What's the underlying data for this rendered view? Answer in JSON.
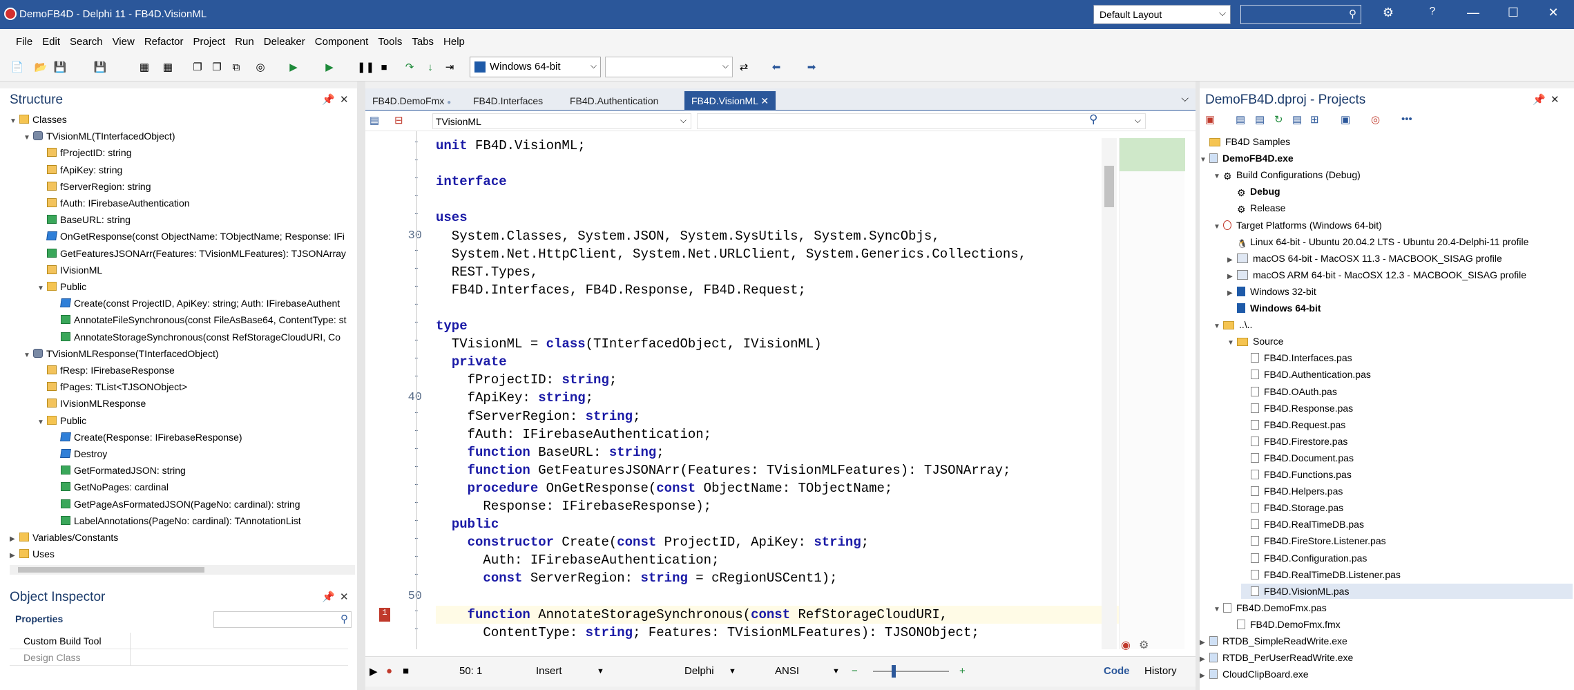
{
  "titlebar": {
    "title": "DemoFB4D - Delphi 11 - FB4D.VisionML",
    "layout": "Default Layout",
    "search_placeholder": ""
  },
  "menu": [
    "File",
    "Edit",
    "Search",
    "View",
    "Refactor",
    "Project",
    "Run",
    "Deleaker",
    "Component",
    "Tools",
    "Tabs",
    "Help"
  ],
  "toolbar": {
    "platform": "Windows 64-bit",
    "config": ""
  },
  "structure": {
    "title": "Structure",
    "items": [
      {
        "t": "Classes",
        "l": 0,
        "icon": "folder"
      },
      {
        "t": "TVisionML(TInterfacedObject)",
        "l": 1,
        "icon": "class"
      },
      {
        "t": "fProjectID: string",
        "l": 2,
        "icon": "field"
      },
      {
        "t": "fApiKey: string",
        "l": 2,
        "icon": "field"
      },
      {
        "t": "fServerRegion: string",
        "l": 2,
        "icon": "field"
      },
      {
        "t": "fAuth: IFirebaseAuthentication",
        "l": 2,
        "icon": "field"
      },
      {
        "t": "BaseURL: string",
        "l": 2,
        "icon": "green"
      },
      {
        "t": "OnGetResponse(const ObjectName: TObjectName; Response: IFi",
        "l": 2,
        "icon": "method"
      },
      {
        "t": "GetFeaturesJSONArr(Features: TVisionMLFeatures): TJSONArray",
        "l": 2,
        "icon": "green"
      },
      {
        "t": "IVisionML",
        "l": 2,
        "icon": "field"
      },
      {
        "t": "Public",
        "l": 2,
        "icon": "folder"
      },
      {
        "t": "Create(const ProjectID, ApiKey: string; Auth: IFirebaseAuthent",
        "l": 3,
        "icon": "method"
      },
      {
        "t": "AnnotateFileSynchronous(const FileAsBase64, ContentType: st",
        "l": 3,
        "icon": "green"
      },
      {
        "t": "AnnotateStorageSynchronous(const RefStorageCloudURI, Co",
        "l": 3,
        "icon": "green"
      },
      {
        "t": "TVisionMLResponse(TInterfacedObject)",
        "l": 1,
        "icon": "class"
      },
      {
        "t": "fResp: IFirebaseResponse",
        "l": 2,
        "icon": "field"
      },
      {
        "t": "fPages: TList<TJSONObject>",
        "l": 2,
        "icon": "field"
      },
      {
        "t": "IVisionMLResponse",
        "l": 2,
        "icon": "field"
      },
      {
        "t": "Public",
        "l": 2,
        "icon": "folder"
      },
      {
        "t": "Create(Response: IFirebaseResponse)",
        "l": 3,
        "icon": "method"
      },
      {
        "t": "Destroy",
        "l": 3,
        "icon": "method"
      },
      {
        "t": "GetFormatedJSON: string",
        "l": 3,
        "icon": "green"
      },
      {
        "t": "GetNoPages: cardinal",
        "l": 3,
        "icon": "green"
      },
      {
        "t": "GetPageAsFormatedJSON(PageNo: cardinal): string",
        "l": 3,
        "icon": "green"
      },
      {
        "t": "LabelAnnotations(PageNo: cardinal): TAnnotationList",
        "l": 3,
        "icon": "green"
      },
      {
        "t": "Variables/Constants",
        "l": 0,
        "icon": "folder"
      },
      {
        "t": "Uses",
        "l": 0,
        "icon": "folder"
      }
    ]
  },
  "object_inspector": {
    "title": "Object Inspector",
    "tab": "Properties",
    "rows": [
      {
        "k": "Custom Build Tool",
        "v": ""
      },
      {
        "k": "Design Class",
        "v": ""
      }
    ]
  },
  "editor": {
    "tabs": [
      "FB4D.DemoFmx",
      "FB4D.Interfaces",
      "FB4D.Authentication",
      "FB4D.VisionML"
    ],
    "nav": "TVisionML",
    "gutter": [
      "-",
      "-",
      "-",
      "-",
      "-",
      "30",
      "-",
      "-",
      "-",
      "-",
      "-",
      "-",
      "-",
      "-",
      "40",
      "-",
      "-",
      "-",
      "-",
      "-",
      "-",
      "-",
      "-",
      "-",
      "-",
      "50",
      "-"
    ],
    "lines": [
      "unit FB4D.VisionML;",
      "",
      "interface",
      "",
      "uses",
      "  System.Classes, System.JSON, System.SysUtils, System.SyncObjs,",
      "  System.Net.HttpClient, System.Net.URLClient, System.Generics.Collections,",
      "  REST.Types,",
      "  FB4D.Interfaces, FB4D.Response, FB4D.Request;",
      "",
      "type",
      "  TVisionML = class(TInterfacedObject, IVisionML)",
      "  private",
      "    fProjectID: string;",
      "    fApiKey: string;",
      "    fServerRegion: string;",
      "    fAuth: IFirebaseAuthentication;",
      "    function BaseURL: string;",
      "    function GetFeaturesJSONArr(Features: TVisionMLFeatures): TJSONArray;",
      "    procedure OnGetResponse(const ObjectName: TObjectName;",
      "      Response: IFirebaseResponse);",
      "  public",
      "    constructor Create(const ProjectID, ApiKey: string;",
      "      Auth: IFirebaseAuthentication;",
      "      const ServerRegion: string = cRegionUSCent1);",
      "",
      "    function AnnotateStorageSynchronous(const RefStorageCloudURI,",
      "      ContentType: string; Features: TVisionMLFeatures): TJSONObject;"
    ],
    "status": {
      "position": "50:  1",
      "mode": "Insert",
      "language": "Delphi",
      "encoding": "ANSI",
      "code_tab": "Code",
      "history_tab": "History"
    }
  },
  "projects": {
    "title": "DemoFB4D.dproj - Projects",
    "items": [
      {
        "t": "FB4D Samples",
        "l": 0,
        "b": false
      },
      {
        "t": "DemoFB4D.exe",
        "l": 0,
        "b": true
      },
      {
        "t": "Build Configurations (Debug)",
        "l": 1,
        "b": false
      },
      {
        "t": "Debug",
        "l": 2,
        "b": true
      },
      {
        "t": "Release",
        "l": 2,
        "b": false
      },
      {
        "t": "Target Platforms (Windows 64-bit)",
        "l": 1,
        "b": false
      },
      {
        "t": "Linux 64-bit - Ubuntu 20.04.2 LTS - Ubuntu 20.4-Delphi-11 profile",
        "l": 2,
        "b": false
      },
      {
        "t": "macOS 64-bit - MacOSX 11.3 - MACBOOK_SISAG profile",
        "l": 2,
        "b": false
      },
      {
        "t": "macOS ARM 64-bit - MacOSX 12.3 - MACBOOK_SISAG profile",
        "l": 2,
        "b": false
      },
      {
        "t": "Windows 32-bit",
        "l": 2,
        "b": false
      },
      {
        "t": "Windows 64-bit",
        "l": 2,
        "b": true
      },
      {
        "t": "..\\..",
        "l": 1,
        "b": false
      },
      {
        "t": "Source",
        "l": 2,
        "b": false
      },
      {
        "t": "FB4D.Interfaces.pas",
        "l": 3,
        "b": false
      },
      {
        "t": "FB4D.Authentication.pas",
        "l": 3,
        "b": false
      },
      {
        "t": "FB4D.OAuth.pas",
        "l": 3,
        "b": false
      },
      {
        "t": "FB4D.Response.pas",
        "l": 3,
        "b": false
      },
      {
        "t": "FB4D.Request.pas",
        "l": 3,
        "b": false
      },
      {
        "t": "FB4D.Firestore.pas",
        "l": 3,
        "b": false
      },
      {
        "t": "FB4D.Document.pas",
        "l": 3,
        "b": false
      },
      {
        "t": "FB4D.Functions.pas",
        "l": 3,
        "b": false
      },
      {
        "t": "FB4D.Helpers.pas",
        "l": 3,
        "b": false
      },
      {
        "t": "FB4D.Storage.pas",
        "l": 3,
        "b": false
      },
      {
        "t": "FB4D.RealTimeDB.pas",
        "l": 3,
        "b": false
      },
      {
        "t": "FB4D.FireStore.Listener.pas",
        "l": 3,
        "b": false
      },
      {
        "t": "FB4D.Configuration.pas",
        "l": 3,
        "b": false
      },
      {
        "t": "FB4D.RealTimeDB.Listener.pas",
        "l": 3,
        "b": false
      },
      {
        "t": "FB4D.VisionML.pas",
        "l": 3,
        "b": false
      },
      {
        "t": "FB4D.DemoFmx.pas",
        "l": 1,
        "b": false
      },
      {
        "t": "FB4D.DemoFmx.fmx",
        "l": 2,
        "b": false
      },
      {
        "t": "RTDB_SimpleReadWrite.exe",
        "l": 0,
        "b": false
      },
      {
        "t": "RTDB_PerUserReadWrite.exe",
        "l": 0,
        "b": false
      },
      {
        "t": "CloudClipBoard.exe",
        "l": 0,
        "b": false
      }
    ]
  },
  "colors": {
    "accent": "#2b579a",
    "keyword": "#1a1aa6",
    "panel_title": "#1a3a6a"
  }
}
